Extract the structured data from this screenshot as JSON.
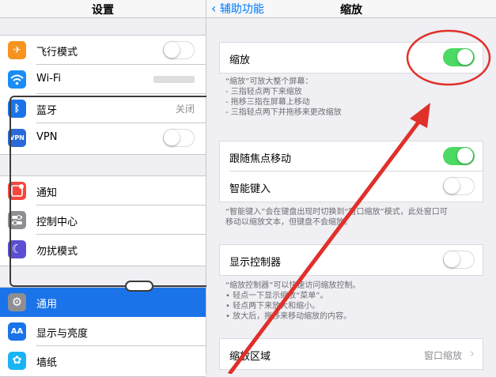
{
  "left_nav": {
    "title": "设置"
  },
  "left_groups": [
    [
      {
        "label": "飞行模式",
        "icon": "airplane-icon",
        "color": "#f7931e",
        "glyph": "✈",
        "toggle": false
      },
      {
        "label": "Wi-Fi",
        "icon": "wifi-icon",
        "color": "#1a8cf5",
        "glyph": "◠",
        "value": ""
      },
      {
        "label": "蓝牙",
        "icon": "bluetooth-icon",
        "color": "#1a73e8",
        "glyph": "ᛒ",
        "value": "关闭"
      },
      {
        "label": "VPN",
        "icon": "vpn-icon",
        "color": "#2a6ad8",
        "glyph": "VPN",
        "toggle": false
      }
    ],
    [
      {
        "label": "通知",
        "icon": "notifications-icon",
        "color": "#f5473e",
        "glyph": "■"
      },
      {
        "label": "控制中心",
        "icon": "control-center-icon",
        "color": "#8e8e93",
        "glyph": "☰"
      },
      {
        "label": "勿扰模式",
        "icon": "moon-icon",
        "color": "#5b4ed1",
        "glyph": "☾"
      }
    ],
    [
      {
        "label": "通用",
        "icon": "gear-icon",
        "color": "#8e8e93",
        "glyph": "⚙",
        "selected": true
      },
      {
        "label": "显示与亮度",
        "icon": "display-icon",
        "color": "#1a73e8",
        "glyph": "AA"
      },
      {
        "label": "墙纸",
        "icon": "wallpaper-icon",
        "color": "#1ab4f5",
        "glyph": "✿"
      }
    ]
  ],
  "right_nav": {
    "back_label": "辅助功能",
    "title": "缩放"
  },
  "zoom": {
    "label": "缩放",
    "on": true
  },
  "zoom_notes": [
    "“缩放”可放大整个屏幕：",
    "- 三指轻点两下来缩放",
    "- 拖移三指在屏幕上移动",
    "- 三指轻点两下并拖移来更改缩放"
  ],
  "focus_group": [
    {
      "label": "跟随焦点移动",
      "on": true
    },
    {
      "label": "智能键入",
      "on": false
    }
  ],
  "smart_typing_note": [
    "“智能键入”会在键盘出现时切换到“窗口缩放”模式，此处窗口可",
    "移动以缩放文本，但键盘不会缩放。"
  ],
  "controller": {
    "label": "显示控制器",
    "on": false
  },
  "controller_notes": [
    "“缩放控制器”可以快速访问缩放控制。",
    "• 轻点一下显示缩放“菜单”。",
    "• 轻点两下来放大和缩小。",
    "• 放大后，拖移来移动缩放的内容。"
  ],
  "zoom_region": {
    "label": "缩放区域",
    "value": "窗口缩放"
  },
  "colors": {
    "accent": "#007aff",
    "toggle_on": "#4cd964",
    "annotation": "#e0302a",
    "selected_row": "#1a73e8"
  }
}
